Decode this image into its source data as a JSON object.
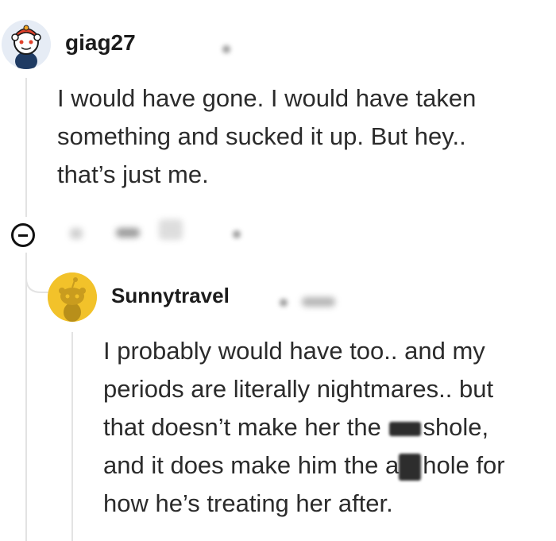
{
  "comments": [
    {
      "username": "giag27",
      "text_lines": [
        "I would have gone. I would have taken",
        "something and sucked it up. But hey..",
        "that’s just me."
      ]
    },
    {
      "username": "Sunnytravel",
      "text_lines": [
        "I probably would have too.. and my",
        "periods are literally nightmares.. but",
        "that doesn’t make her the ",
        "shole,",
        "and it does make him the a",
        "hole for",
        "how he’s treating her after."
      ]
    }
  ],
  "icons": {
    "collapse": "minus-circle-icon",
    "avatar_1": "snoo-avatar-icon",
    "avatar_2": "snoo-avatar-icon"
  },
  "colors": {
    "avatar_2_bg": "#f2c22a",
    "thread_line": "#e3e3e3"
  }
}
